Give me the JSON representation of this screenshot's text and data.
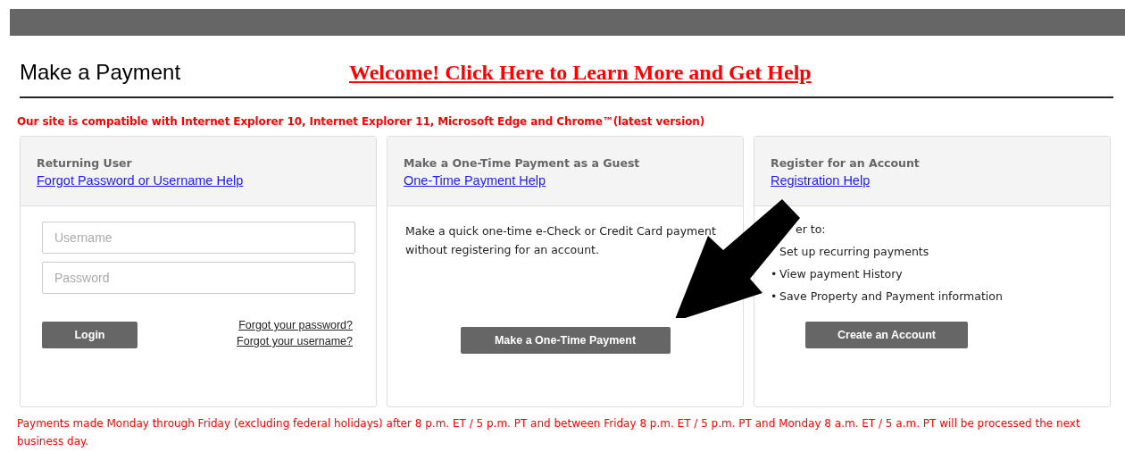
{
  "header": {
    "title": "Make a Payment",
    "help_link": "Welcome! Click Here to Learn More and Get Help"
  },
  "compat_notice": "Our site is compatible with Internet Explorer 10, Internet Explorer 11, Microsoft Edge and Chrome™(latest version)",
  "cards": [
    {
      "kind": "login",
      "title": "Returning User",
      "help_link": "Forgot Password or Username Help",
      "fields": [
        {
          "placeholder": "Username"
        },
        {
          "placeholder": "Password"
        }
      ],
      "button": "Login",
      "links": [
        "Forgot your password?",
        "Forgot your username?"
      ]
    },
    {
      "kind": "guest",
      "title": "Make a One-Time Payment as a Guest",
      "help_link": "One-Time Payment Help",
      "text": "Make a quick one-time e-Check or Credit Card payment without registering for an account.",
      "button": "Make a One-Time Payment"
    },
    {
      "kind": "register",
      "title": "Register for an Account",
      "help_link": "Registration Help",
      "intro": "er to:",
      "items": [
        {
          "text": "Set up recurring payments"
        },
        {
          "bullet": "•",
          "text": "View payment History"
        },
        {
          "bullet": "•",
          "text": "Save Property and Payment information"
        }
      ],
      "button": "Create an Account"
    }
  ],
  "processing_notice": "Payments made Monday through Friday (excluding federal holidays) after 8 p.m. ET / 5 p.m. PT and between Friday 8 p.m. ET / 5 p.m. PT and Monday 8 a.m. ET / 5 a.m. PT will be processed the next business day."
}
